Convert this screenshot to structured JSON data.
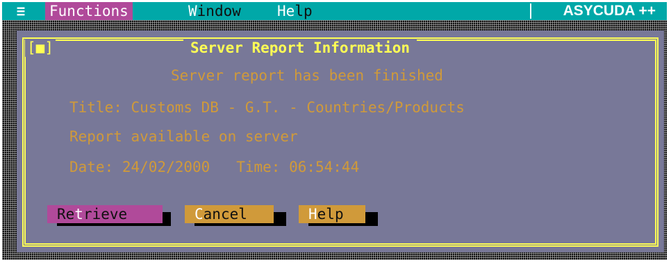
{
  "menubar": {
    "system_icon": "≡",
    "items": [
      {
        "hot": "F",
        "rest": "unctions",
        "selected": true
      },
      {
        "hot": "W",
        "rest": "indow",
        "selected": false
      },
      {
        "pre": "H",
        "hot": "e",
        "rest": "lp",
        "selected": false
      }
    ],
    "brand": "ASYCUDA ++"
  },
  "dialog": {
    "close_icon": "[■]",
    "title": "Server Report Information",
    "heading": "Server report has been finished",
    "title_line": "Title: Customs DB - G.T. - Countries/Products",
    "availability": "Report available on server",
    "date_line": "Date: 24/02/2000   Time: 06:54:44",
    "buttons": {
      "retrieve": {
        "pre": "Re",
        "hot": "t",
        "rest": "rieve"
      },
      "cancel": {
        "hot": "C",
        "rest": "ancel"
      },
      "help": {
        "hot": "H",
        "rest": "elp"
      }
    }
  },
  "colors": {
    "menubar": "#00a8a8",
    "dialog_bg": "#787898",
    "frame": "#ffff55",
    "text": "#d09a3a",
    "selected_button": "#b04a9a",
    "button": "#d09a3a"
  }
}
